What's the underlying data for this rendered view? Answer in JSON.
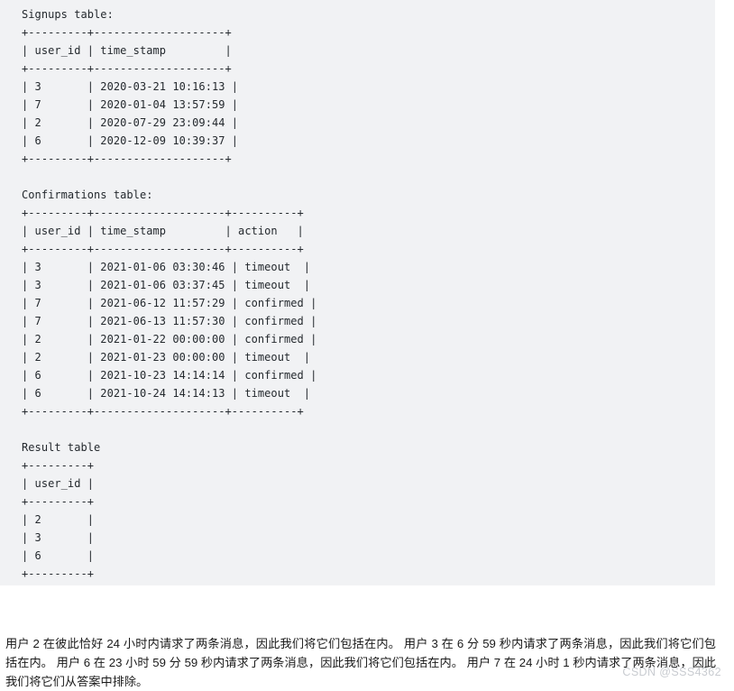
{
  "code_block": {
    "background_color": "#f1f2f4",
    "text_color": "#24292e",
    "lines": [
      "Signups table:",
      "+---------+--------------------+",
      "| user_id | time_stamp         |",
      "+---------+--------------------+",
      "| 3       | 2020-03-21 10:16:13 |",
      "| 7       | 2020-01-04 13:57:59 |",
      "| 2       | 2020-07-29 23:09:44 |",
      "| 6       | 2020-12-09 10:39:37 |",
      "+---------+--------------------+",
      "",
      "Confirmations table:",
      "+---------+--------------------+----------+",
      "| user_id | time_stamp         | action   |",
      "+---------+--------------------+----------+",
      "| 3       | 2021-01-06 03:30:46 | timeout  |",
      "| 3       | 2021-01-06 03:37:45 | timeout  |",
      "| 7       | 2021-06-12 11:57:29 | confirmed |",
      "| 7       | 2021-06-13 11:57:30 | confirmed |",
      "| 2       | 2021-01-22 00:00:00 | confirmed |",
      "| 2       | 2021-01-23 00:00:00 | timeout  |",
      "| 6       | 2021-10-23 14:14:14 | confirmed |",
      "| 6       | 2021-10-24 14:14:13 | timeout  |",
      "+---------+--------------------+----------+",
      "",
      "Result table",
      "+---------+",
      "| user_id |",
      "+---------+",
      "| 2       |",
      "| 3       |",
      "| 6       |",
      "+---------+"
    ],
    "tables": [
      {
        "name": "Signups table:",
        "columns": [
          "user_id",
          "time_stamp"
        ],
        "rows": [
          [
            "3",
            "2020-03-21 10:16:13"
          ],
          [
            "7",
            "2020-01-04 13:57:59"
          ],
          [
            "2",
            "2020-07-29 23:09:44"
          ],
          [
            "6",
            "2020-12-09 10:39:37"
          ]
        ]
      },
      {
        "name": "Confirmations table:",
        "columns": [
          "user_id",
          "time_stamp",
          "action"
        ],
        "rows": [
          [
            "3",
            "2021-01-06 03:30:46",
            "timeout"
          ],
          [
            "3",
            "2021-01-06 03:37:45",
            "timeout"
          ],
          [
            "7",
            "2021-06-12 11:57:29",
            "confirmed"
          ],
          [
            "7",
            "2021-06-13 11:57:30",
            "confirmed"
          ],
          [
            "2",
            "2021-01-22 00:00:00",
            "confirmed"
          ],
          [
            "2",
            "2021-01-23 00:00:00",
            "timeout"
          ],
          [
            "6",
            "2021-10-23 14:14:14",
            "confirmed"
          ],
          [
            "6",
            "2021-10-24 14:14:13",
            "timeout"
          ]
        ]
      },
      {
        "name": "Result table",
        "columns": [
          "user_id"
        ],
        "rows": [
          [
            "2"
          ],
          [
            "3"
          ],
          [
            "6"
          ]
        ]
      }
    ]
  },
  "explanation": {
    "text": "用户 2 在彼此恰好 24 小时内请求了两条消息，因此我们将它们包括在内。 用户 3 在 6 分 59 秒内请求了两条消息，因此我们将它们包括在内。 用户 6 在 23 小时 59 分 59 秒内请求了两条消息，因此我们将它们包括在内。 用户 7 在 24 小时 1 秒内请求了两条消息，因此我们将它们从答案中排除。"
  },
  "watermark": {
    "text": "CSDN @SSS4362",
    "color": "#c9ccd1"
  }
}
